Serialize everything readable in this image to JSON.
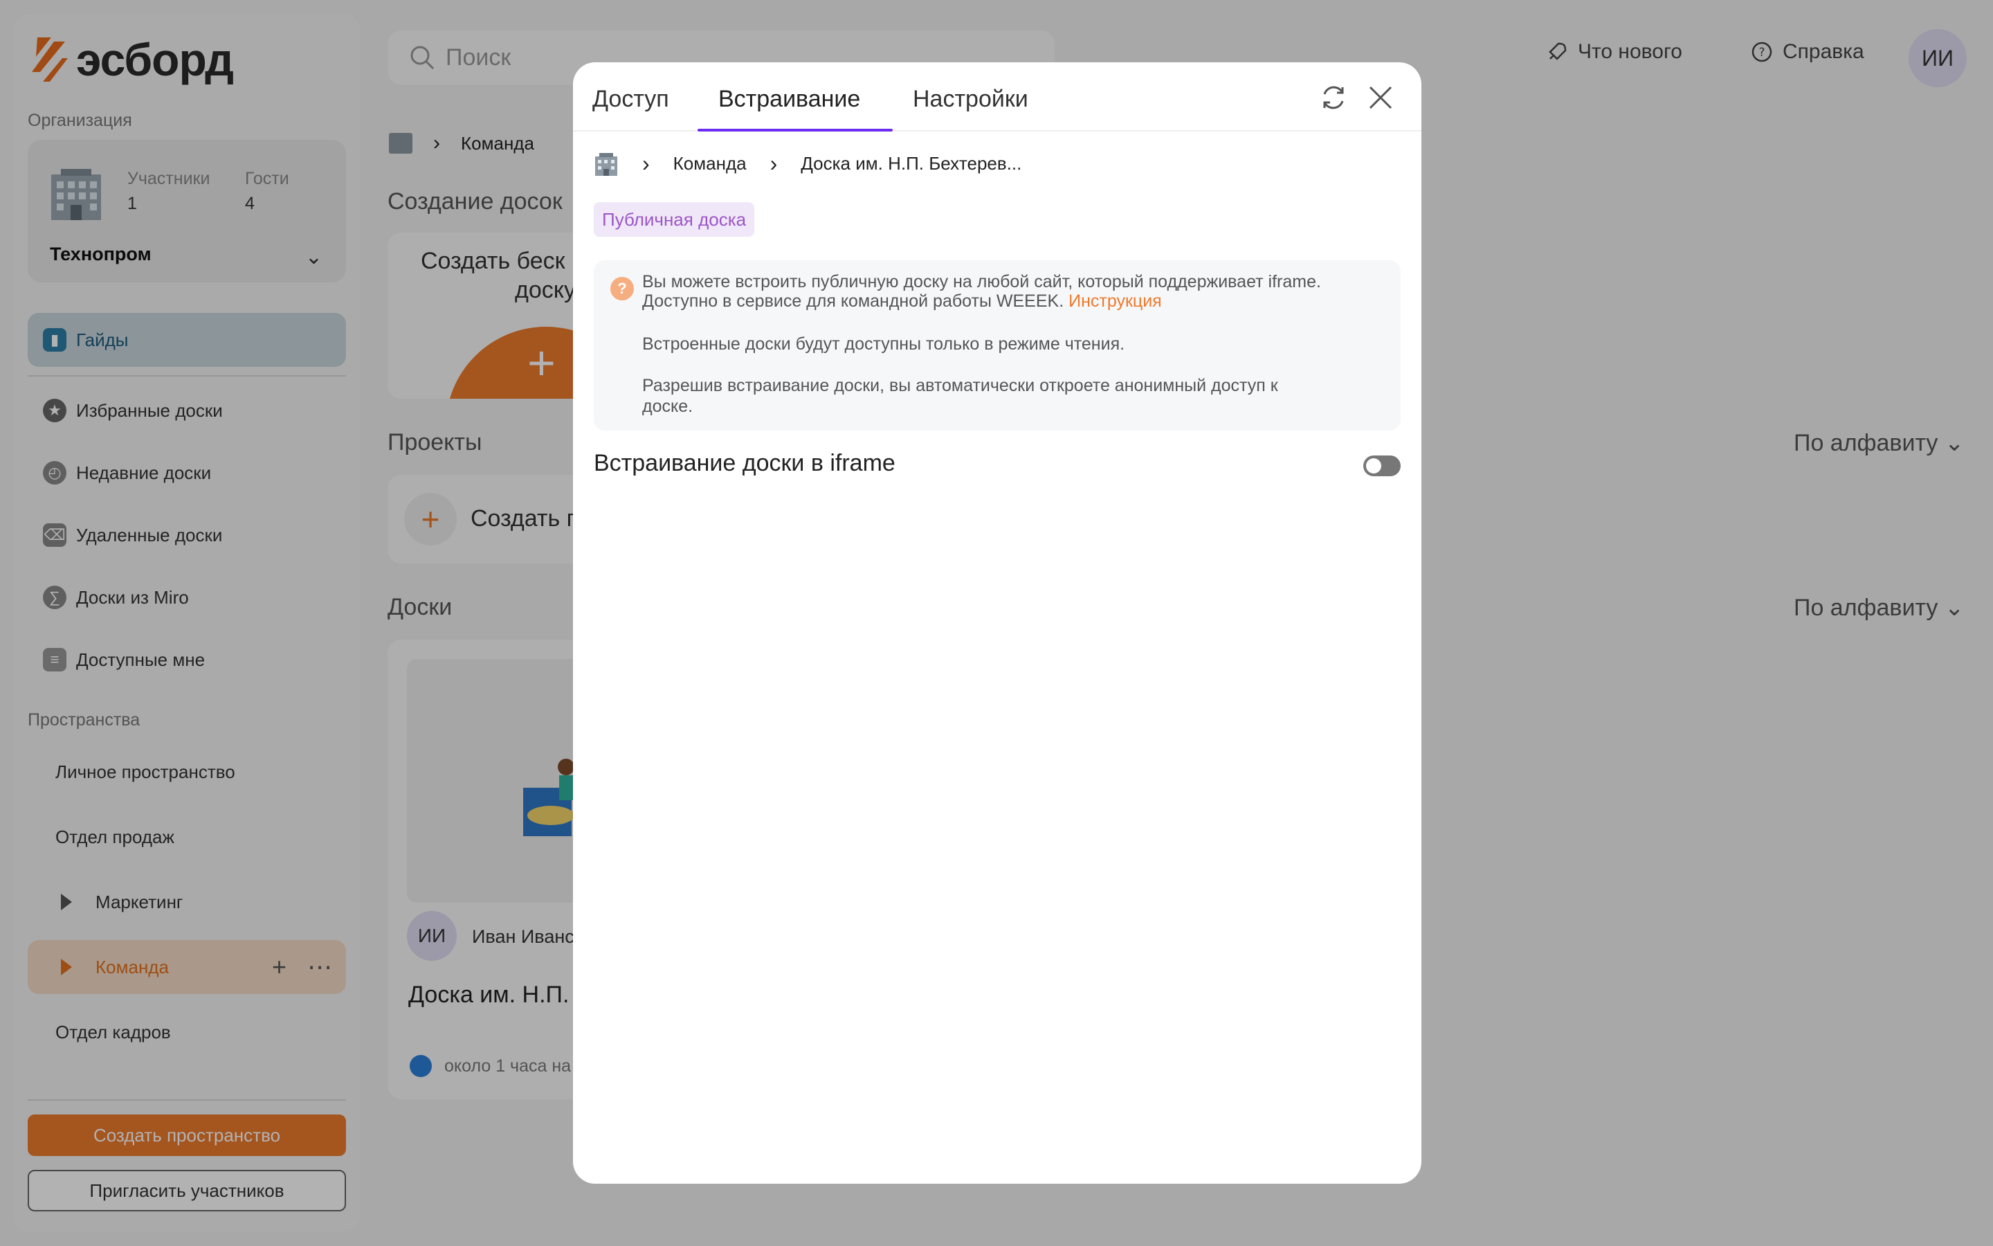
{
  "app": {
    "logo_text": "эсборд",
    "search_placeholder": "Поиск",
    "whats_new": "Что нового",
    "help": "Справка",
    "avatar_initials": "ИИ"
  },
  "sidebar": {
    "org_label": "Организация",
    "org": {
      "members_label": "Участники",
      "members_value": "1",
      "guests_label": "Гости",
      "guests_value": "4",
      "name": "Технопром"
    },
    "items": [
      {
        "label": "Гайды"
      },
      {
        "label": "Избранные доски"
      },
      {
        "label": "Недавние доски"
      },
      {
        "label": "Удаленные доски"
      },
      {
        "label": "Доски из Miro"
      },
      {
        "label": "Доступные мне"
      }
    ],
    "spaces_label": "Пространства",
    "spaces": [
      {
        "label": "Личное пространство"
      },
      {
        "label": "Отдел продаж"
      },
      {
        "label": "Маркетинг"
      },
      {
        "label": "Команда"
      },
      {
        "label": "Отдел кадров"
      }
    ],
    "create_space": "Создать пространство",
    "invite": "Пригласить участников"
  },
  "main": {
    "breadcrumb": "Команда",
    "create_heading": "Создание досок",
    "create_card_text_1": "Создать беск",
    "create_card_text_2": "доску",
    "projects_heading": "Проекты",
    "projects_sort": "По алфавиту",
    "create_project": "Создать п",
    "boards_heading": "Доски",
    "boards_sort": "По алфавиту",
    "board_owner_initials": "ИИ",
    "board_owner": "Иван Иванс",
    "board_title": "Доска им. Н.П.",
    "board_updated": "около 1 часа на"
  },
  "modal": {
    "tabs": [
      "Доступ",
      "Встраивание",
      "Настройки"
    ],
    "breadcrumb": {
      "space": "Команда",
      "board": "Доска им. Н.П. Бехтерев..."
    },
    "badge": "Публичная доска",
    "info": {
      "line1": "Вы можете встроить публичную доску на любой сайт, который поддерживает iframe.",
      "line2": "Доступно в сервисе для командной работы WEEEK.",
      "link": "Инструкция",
      "line3": "Встроенные доски будут доступны только в режиме чтения.",
      "line4": "Разрешив встраивание доски, вы автоматически откроете анонимный доступ к",
      "line5": "доске."
    },
    "embed_label": "Встраивание доски в iframe",
    "embed_enabled": false
  }
}
